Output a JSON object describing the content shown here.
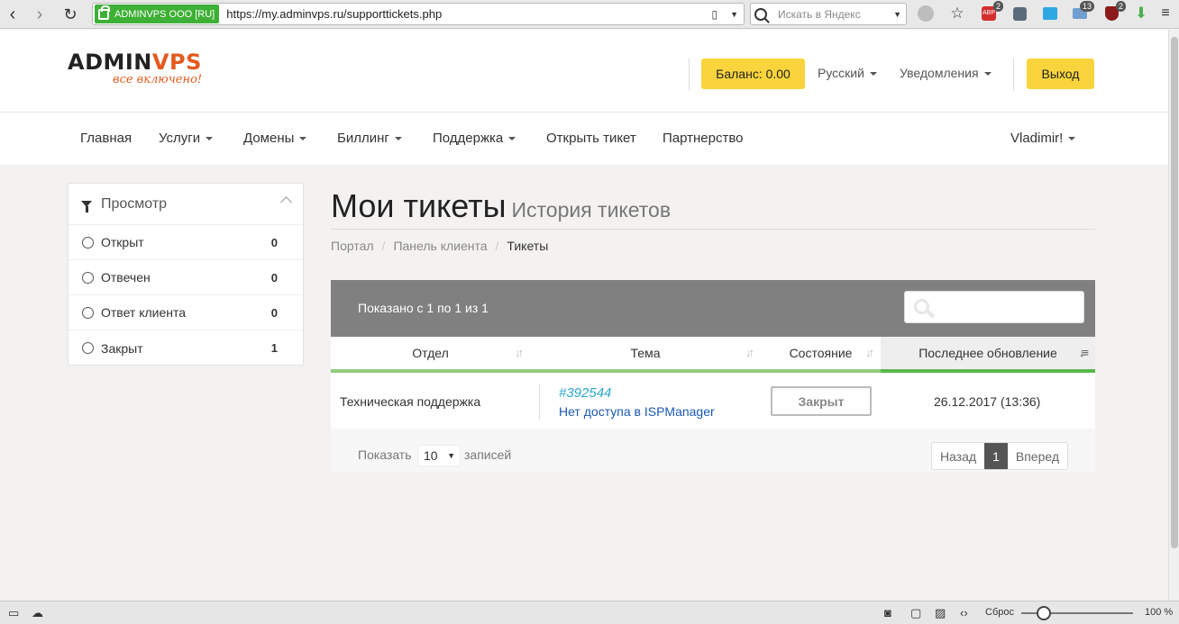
{
  "browser": {
    "site_badge": "ADMINVPS ООО [RU]",
    "url": "https://my.adminvps.ru/supporttickets.php",
    "search_placeholder": "Искать в Яндекс",
    "ext_abp_count": "2",
    "ext_mail_count": "13",
    "ext_ublock_count": "2"
  },
  "header": {
    "logo_main_1": "ADMIN",
    "logo_main_2": "V",
    "logo_main_3": "PS",
    "logo_tagline": "все включено!",
    "balance": "Баланс: 0.00",
    "language": "Русский",
    "notifications": "Уведомления",
    "logout": "Выход"
  },
  "nav": {
    "home": "Главная",
    "services": "Услуги",
    "domains": "Домены",
    "billing": "Биллинг",
    "support": "Поддержка",
    "open_ticket": "Открыть тикет",
    "partnership": "Партнерство",
    "user": "Vladimir!"
  },
  "sidebar": {
    "title": "Просмотр",
    "filters": [
      {
        "label": "Открыт",
        "count": "0"
      },
      {
        "label": "Отвечен",
        "count": "0"
      },
      {
        "label": "Ответ клиента",
        "count": "0"
      },
      {
        "label": "Закрыт",
        "count": "1"
      }
    ]
  },
  "page": {
    "title": "Мои тикеты",
    "subtitle": "История тикетов",
    "breadcrumb": [
      "Портал",
      "Панель клиента",
      "Тикеты"
    ]
  },
  "table": {
    "info": "Показано с 1 по 1 из 1",
    "columns": [
      "Отдел",
      "Тема",
      "Состояние",
      "Последнее обновление"
    ],
    "rows": [
      {
        "department": "Техническая поддержка",
        "ticket_id": "#392544",
        "subject": "Нет доступа в ISPManager",
        "status": "Закрыт",
        "updated": "26.12.2017 (13:36)"
      }
    ],
    "show_label": "Показать",
    "page_length": "10",
    "entries_label": "записей",
    "prev": "Назад",
    "current_page": "1",
    "next": "Вперед"
  },
  "statusbar": {
    "reset_label": "Сброс",
    "zoom": "100 %"
  }
}
